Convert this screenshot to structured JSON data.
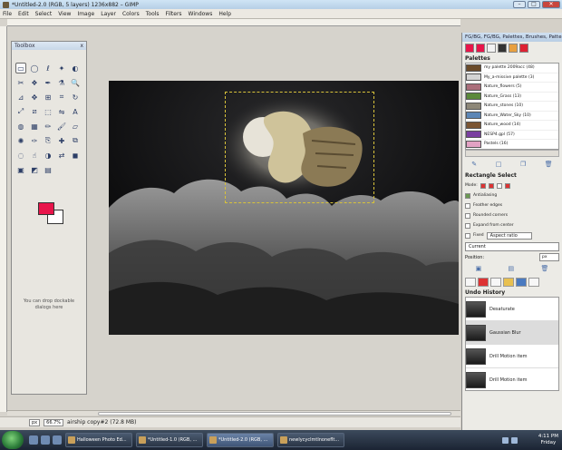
{
  "window": {
    "title": "*Untitled-2.0 (RGB, 5 layers) 1236x882 – GIMP",
    "min": "–",
    "max": "□",
    "close": "✕"
  },
  "menu": [
    "File",
    "Edit",
    "Select",
    "View",
    "Image",
    "Layer",
    "Colors",
    "Tools",
    "Filters",
    "Windows",
    "Help"
  ],
  "toolbox": {
    "title": "Toolbox",
    "close": "x",
    "tools": [
      "rect-select-icon",
      "ellipse-select-icon",
      "free-select-icon",
      "fuzzy-select-icon",
      "color-select-icon",
      "scissors-icon",
      "foreground-select-icon",
      "paths-icon",
      "color-picker-icon",
      "zoom-icon",
      "measure-icon",
      "move-icon",
      "align-icon",
      "crop-icon",
      "rotate-icon",
      "scale-icon",
      "shear-icon",
      "perspective-icon",
      "flip-icon",
      "text-icon",
      "bucket-fill-icon",
      "blend-icon",
      "pencil-icon",
      "paintbrush-icon",
      "eraser-icon",
      "airbrush-icon",
      "ink-icon",
      "clone-icon",
      "heal-icon",
      "perspective-clone-icon",
      "blur-icon",
      "smudge-icon",
      "dodge-burn-icon",
      "color-swap-icon",
      "color-reset-icon",
      "quick-mask-icon",
      "default-colors-icon",
      "layer-icon"
    ],
    "fg_color": "#e8154a",
    "bg_color": "#ffffff",
    "drop_hint": "You can drop dockable dialogs here"
  },
  "status": {
    "unit": "px",
    "zoom": "66.7%",
    "message": "airship copy#2 (72.8 MB)"
  },
  "dock": {
    "title": "FG/BG, FG/BG, Palettes, Brushes, Patterns",
    "palettes_label": "Palettes",
    "palettes": [
      {
        "name": "my palette 2009acc (48)",
        "color": "#6b4b2a"
      },
      {
        "name": "My_a-missive palette (3)",
        "color": "#d4d4d4"
      },
      {
        "name": "Nature_flowers (5)",
        "color": "#ab6f7b"
      },
      {
        "name": "Nature_Grass (13)",
        "color": "#5b8a3a"
      },
      {
        "name": "Nature_stones (10)",
        "color": "#8d8778"
      },
      {
        "name": "Nature_Water_Sky (10)",
        "color": "#5c86b6"
      },
      {
        "name": "Nature_wood (14)",
        "color": "#7b5533"
      },
      {
        "name": "NESP4.gpl (57)",
        "color": "#7a3fa0"
      },
      {
        "name": "Pastels (16)",
        "color": "#e2a2c3"
      }
    ],
    "tool_options": {
      "label": "Rectangle Select",
      "mode": "Mode:",
      "antialiasing": "Antialiasing",
      "feather": "Feather edges",
      "rounded": "Rounded corners",
      "expand": "Expand from center",
      "fixed": "Fixed",
      "aspect": "Aspect ratio",
      "current": "Current",
      "position": "Position:",
      "unit": "px"
    },
    "history_label": "Undo History",
    "history": [
      "Desaturate",
      "Gaussian Blur",
      "Drill Motion item",
      "Drill Motion item",
      "Drill Motion item"
    ]
  },
  "taskbar": {
    "tasks": [
      "Halloween Photo Ed...",
      "*Untitled-1.0 (RGB, ...",
      "*Untitled-2.0 (RGB, ...",
      "newlycyclmtlnoneflt..."
    ],
    "clock_time": "4:11 PM",
    "clock_day": "Friday"
  }
}
